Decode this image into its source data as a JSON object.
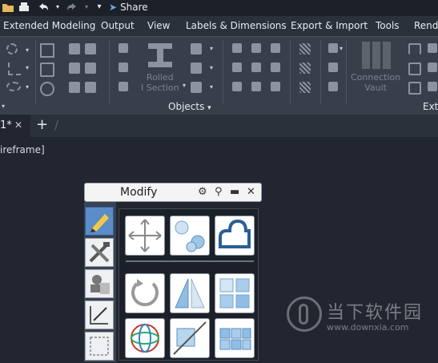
{
  "quick_access": {
    "share_label": "Share",
    "icons": [
      "folder-icon",
      "print-icon",
      "undo-icon",
      "redo-icon",
      "dropdown-icon"
    ]
  },
  "menubar": {
    "tabs": [
      {
        "label": "Extended Modeling"
      },
      {
        "label": "Output"
      },
      {
        "label": "View"
      },
      {
        "label": "Labels & Dimensions"
      },
      {
        "label": "Export & Import"
      },
      {
        "label": "Tools"
      },
      {
        "label": "Rende"
      }
    ]
  },
  "ribbon": {
    "rolled_section_label": "Rolled\nI Section",
    "objects_panel_title": "Objects",
    "connection_vault_label": "Connection\nVault",
    "ext_panel_title": "Ext"
  },
  "doc_tabs": {
    "active_tab_label": "1*",
    "close_glyph": "✕",
    "new_tab_glyph": "+"
  },
  "viewport": {
    "visual_style_label": "ireframe]"
  },
  "tool_palette": {
    "title": "Modify",
    "sidebar": [
      "pencil-tool",
      "tools-tool",
      "properties-tool",
      "dimension-tool",
      "selection-tool"
    ],
    "tools": [
      "move",
      "copy",
      "stretch",
      "rotate",
      "mirror",
      "array",
      "rotate3d",
      "cut",
      "explode"
    ]
  },
  "watermark": {
    "chinese": "当下软件园",
    "url": "www.downxia.com"
  }
}
